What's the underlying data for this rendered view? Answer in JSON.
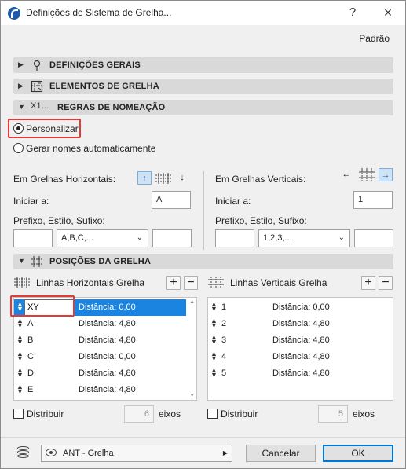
{
  "window": {
    "title": "Definições de Sistema de Grelha...",
    "help": "?",
    "close": "×"
  },
  "header": {
    "preset": "Padrão"
  },
  "sections": {
    "general": "DEFINIÇÕES GERAIS",
    "elements": "ELEMENTOS DE GRELHA",
    "naming": "REGRAS DE NOMEAÇÃO",
    "naming_icon": "X1...",
    "positions": "POSIÇÕES DA GRELHA"
  },
  "naming": {
    "custom": "Personalizar",
    "auto": "Gerar nomes automaticamente",
    "horizontal": {
      "title": "Em Grelhas Horizontais:",
      "start_label": "Iniciar a:",
      "start_value": "A",
      "prefix_label": "Prefixo, Estilo, Sufixo:",
      "prefix": "",
      "style": "A,B,C,...",
      "suffix": ""
    },
    "vertical": {
      "title": "Em Grelhas Verticais:",
      "start_label": "Iniciar a:",
      "start_value": "1",
      "prefix_label": "Prefixo, Estilo, Sufixo:",
      "prefix": "",
      "style": "1,2,3,...",
      "suffix": ""
    }
  },
  "positions": {
    "horizontal": {
      "title": "Linhas Horizontais Grelha",
      "add": "+",
      "remove": "−",
      "rows": [
        {
          "name": "XY",
          "distance": "Distância:  0,00"
        },
        {
          "name": "A",
          "distance": "Distância:  4,80"
        },
        {
          "name": "B",
          "distance": "Distância:  4,80"
        },
        {
          "name": "C",
          "distance": "Distância:  0,00"
        },
        {
          "name": "D",
          "distance": "Distância:  4,80"
        },
        {
          "name": "E",
          "distance": "Distância:  4,80"
        }
      ],
      "distribute": "Distribuir",
      "axes_count": "6",
      "axes_label": "eixos"
    },
    "vertical": {
      "title": "Linhas Verticais Grelha",
      "add": "+",
      "remove": "−",
      "rows": [
        {
          "name": "1",
          "distance": "Distância:  0,00"
        },
        {
          "name": "2",
          "distance": "Distância:  4,80"
        },
        {
          "name": "3",
          "distance": "Distância:  4,80"
        },
        {
          "name": "4",
          "distance": "Distância:  4,80"
        },
        {
          "name": "5",
          "distance": "Distância:  4,80"
        }
      ],
      "distribute": "Distribuir",
      "axes_count": "5",
      "axes_label": "eixos"
    }
  },
  "footer": {
    "layer": "ANT - Grelha",
    "cancel": "Cancelar",
    "ok": "OK"
  }
}
